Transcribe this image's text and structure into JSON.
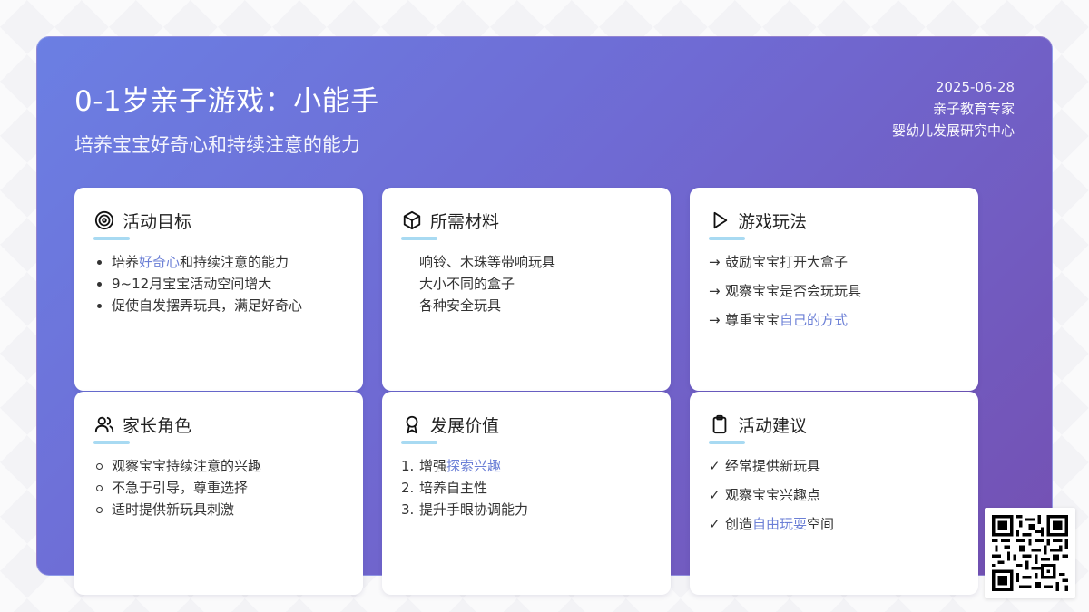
{
  "header": {
    "title": "0-1岁亲子游戏：小能手",
    "subtitle": "培养宝宝好奇心和持续注意的能力",
    "date": "2025-06-28",
    "author": "亲子教育专家",
    "organization": "婴幼儿发展研究中心"
  },
  "cards": [
    {
      "title": "活动目标",
      "icon": "target-icon",
      "items": [
        {
          "pre": "培养",
          "hl": "好奇心",
          "post": "和持续注意的能力"
        },
        {
          "pre": "9~12月宝宝活动空间增大",
          "hl": "",
          "post": ""
        },
        {
          "pre": "促使自发摆弄玩具，满足好奇心",
          "hl": "",
          "post": ""
        }
      ]
    },
    {
      "title": "所需材料",
      "icon": "box-icon",
      "items": [
        {
          "pre": "响铃、木珠等带响玩具",
          "hl": "",
          "post": ""
        },
        {
          "pre": "大小不同的盒子",
          "hl": "",
          "post": ""
        },
        {
          "pre": "各种安全玩具",
          "hl": "",
          "post": ""
        }
      ]
    },
    {
      "title": "游戏玩法",
      "icon": "play-icon",
      "marker": "→",
      "items": [
        {
          "pre": "鼓励宝宝打开大盒子",
          "hl": "",
          "post": ""
        },
        {
          "pre": "观察宝宝是否会玩玩具",
          "hl": "",
          "post": ""
        },
        {
          "pre": "尊重宝宝",
          "hl": "自己的方式",
          "post": ""
        }
      ]
    },
    {
      "title": "家长角色",
      "icon": "users-icon",
      "items": [
        {
          "pre": "观察宝宝持续注意的兴趣",
          "hl": "",
          "post": ""
        },
        {
          "pre": "不急于引导，尊重选择",
          "hl": "",
          "post": ""
        },
        {
          "pre": "适时提供新玩具刺激",
          "hl": "",
          "post": ""
        }
      ]
    },
    {
      "title": "发展价值",
      "icon": "award-icon",
      "numbers": [
        "1.",
        "2.",
        "3."
      ],
      "items": [
        {
          "pre": "增强",
          "hl": "探索兴趣",
          "post": ""
        },
        {
          "pre": "培养自主性",
          "hl": "",
          "post": ""
        },
        {
          "pre": "提升手眼协调能力",
          "hl": "",
          "post": ""
        }
      ]
    },
    {
      "title": "活动建议",
      "icon": "clipboard-icon",
      "marker": "✓",
      "items": [
        {
          "pre": "经常提供新玩具",
          "hl": "",
          "post": ""
        },
        {
          "pre": "观察宝宝兴趣点",
          "hl": "",
          "post": ""
        },
        {
          "pre": "创造",
          "hl": "自由玩耍",
          "post": "空间"
        }
      ]
    }
  ],
  "colors": {
    "gradient_start": "#6b7fe3",
    "gradient_end": "#7450b2",
    "highlight": "#6b7fd6",
    "underline": "#a8daf2"
  },
  "qr_code": "qr-code-icon"
}
